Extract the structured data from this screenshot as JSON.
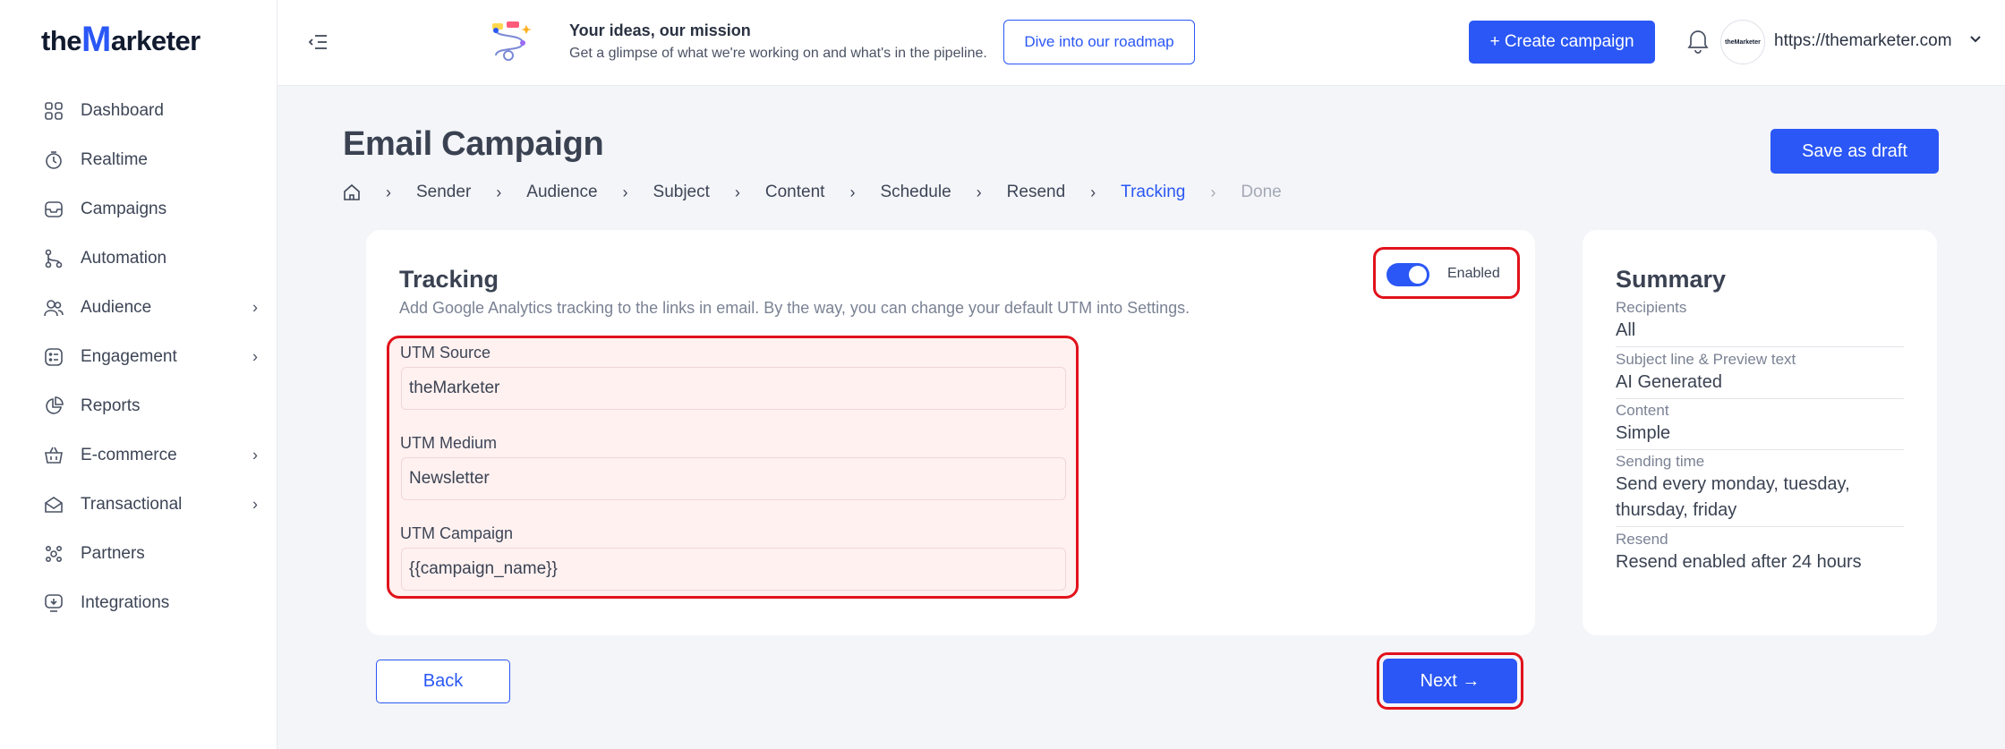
{
  "logo": {
    "prefix": "the",
    "m": "M",
    "suffix": "arketer"
  },
  "sidebar": {
    "items": [
      {
        "label": "Dashboard",
        "icon": "grid-icon",
        "has_children": false
      },
      {
        "label": "Realtime",
        "icon": "clock-icon",
        "has_children": false
      },
      {
        "label": "Campaigns",
        "icon": "campaigns-icon",
        "has_children": false
      },
      {
        "label": "Automation",
        "icon": "automation-icon",
        "has_children": false
      },
      {
        "label": "Audience",
        "icon": "users-icon",
        "has_children": true
      },
      {
        "label": "Engagement",
        "icon": "engagement-icon",
        "has_children": true
      },
      {
        "label": "Reports",
        "icon": "pie-chart-icon",
        "has_children": false
      },
      {
        "label": "E-commerce",
        "icon": "basket-icon",
        "has_children": true
      },
      {
        "label": "Transactional",
        "icon": "envelope-open-icon",
        "has_children": true
      },
      {
        "label": "Partners",
        "icon": "partners-icon",
        "has_children": false
      },
      {
        "label": "Integrations",
        "icon": "integrations-icon",
        "has_children": false
      }
    ]
  },
  "topbar": {
    "promo_title": "Your ideas, our mission",
    "promo_subtitle": "Get a glimpse of what we're working on and what's in the pipeline.",
    "roadmap_label": "Dive into our roadmap",
    "create_label": "+ Create campaign",
    "avatar_text": "theMarketer",
    "site_url": "https://themarketer.com"
  },
  "page": {
    "title": "Email Campaign",
    "save_draft_label": "Save as draft"
  },
  "breadcrumb": [
    {
      "label": "Sender",
      "state": "done"
    },
    {
      "label": "Audience",
      "state": "done"
    },
    {
      "label": "Subject",
      "state": "done"
    },
    {
      "label": "Content",
      "state": "done"
    },
    {
      "label": "Schedule",
      "state": "done"
    },
    {
      "label": "Resend",
      "state": "done"
    },
    {
      "label": "Tracking",
      "state": "active"
    },
    {
      "label": "Done",
      "state": "disabled"
    }
  ],
  "tracking": {
    "title": "Tracking",
    "description": "Add Google Analytics tracking to the links in email. By the way, you can change your default UTM into Settings.",
    "toggle_label": "Enabled",
    "toggle_on": true,
    "fields": {
      "source": {
        "label": "UTM Source",
        "value": "theMarketer"
      },
      "medium": {
        "label": "UTM Medium",
        "value": "Newsletter"
      },
      "campaign": {
        "label": "UTM Campaign",
        "value": "{{campaign_name}}"
      }
    }
  },
  "actions": {
    "back_label": "Back",
    "next_label": "Next →"
  },
  "summary": {
    "title": "Summary",
    "rows": [
      {
        "label": "Recipients",
        "value": "All"
      },
      {
        "label": "Subject line & Preview text",
        "value": "AI Generated"
      },
      {
        "label": "Content",
        "value": "Simple"
      },
      {
        "label": "Sending time",
        "value": "Send every monday, tuesday, thursday, friday"
      },
      {
        "label": "Resend",
        "value": "Resend enabled after 24 hours"
      }
    ]
  },
  "colors": {
    "accent": "#2a57f5",
    "highlight_border": "#e1121b",
    "highlight_fill": "#fff1f0"
  }
}
